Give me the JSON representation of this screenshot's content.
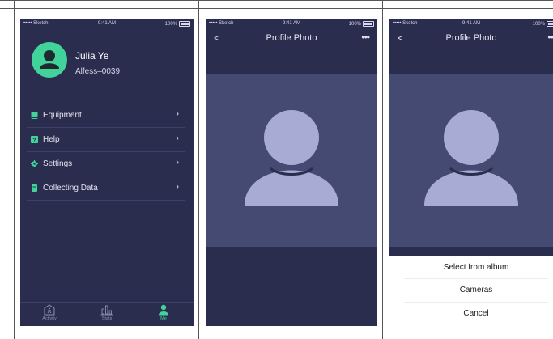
{
  "colors": {
    "screen_bg": "#2b2d4f",
    "photo_bg": "#454a73",
    "accent": "#41d39a",
    "silhouette": "#a8abd3"
  },
  "status_bar": {
    "carrier": "••••• Sketch",
    "time": "9:41 AM",
    "battery": "100%"
  },
  "profile": {
    "name": "Julia Ye",
    "id": "Alfess–0039"
  },
  "menu": [
    {
      "label": "Equipment",
      "icon": "book-icon"
    },
    {
      "label": "Help",
      "icon": "question-icon"
    },
    {
      "label": "Settings",
      "icon": "gear-icon"
    },
    {
      "label": "Collecting Data",
      "icon": "document-icon"
    }
  ],
  "tabs": [
    {
      "label": "Activity",
      "icon": "activity-icon"
    },
    {
      "label": "Stats",
      "icon": "stats-icon"
    },
    {
      "label": "Me",
      "icon": "person-icon"
    }
  ],
  "photo_screen": {
    "title": "Profile Photo",
    "back": "<",
    "more": "•••"
  },
  "action_sheet": {
    "options": [
      "Select from album",
      "Cameras",
      "Cancel"
    ]
  }
}
